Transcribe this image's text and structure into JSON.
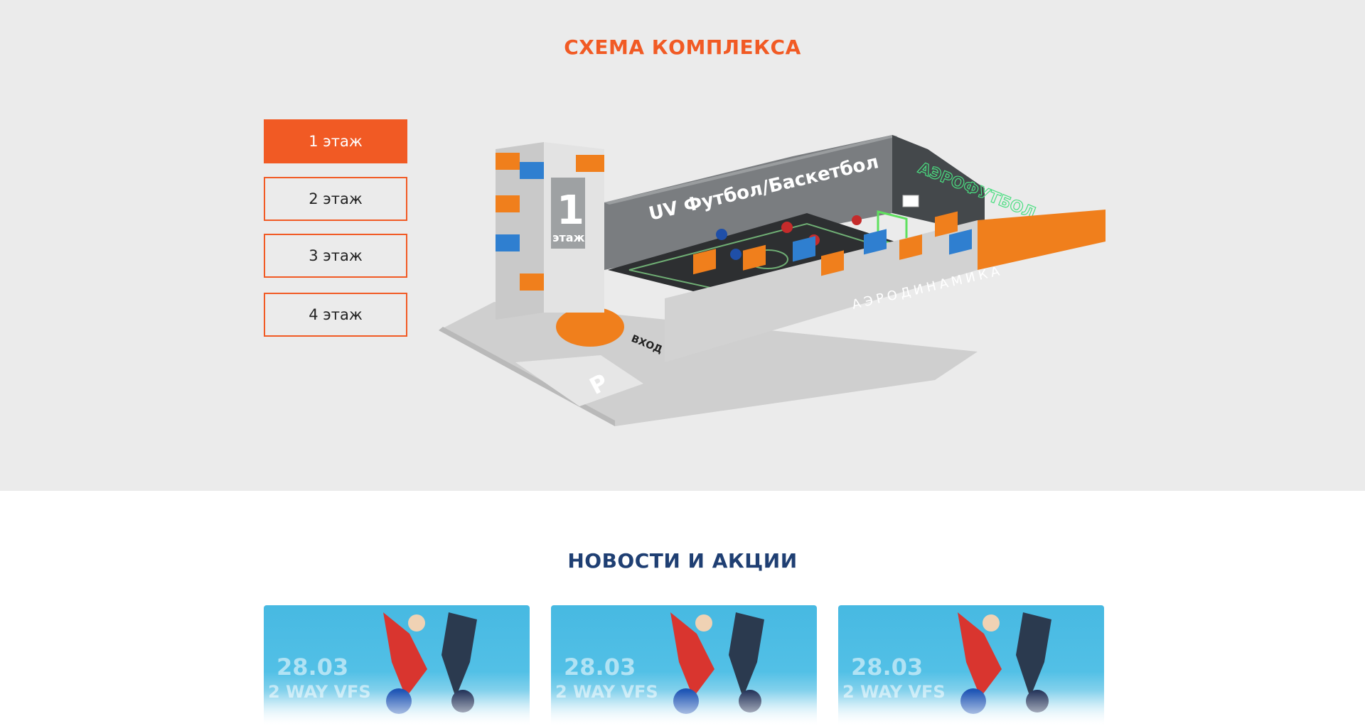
{
  "scheme": {
    "title": "СХЕМА КОМПЛЕКСА",
    "floors": [
      {
        "label": "1 этаж",
        "active": true
      },
      {
        "label": "2 этаж",
        "active": false
      },
      {
        "label": "3 этаж",
        "active": false
      },
      {
        "label": "4 этаж",
        "active": false
      }
    ],
    "map": {
      "floor_number": "1",
      "floor_word": "этаж",
      "zone_football": "UV Футбол/Баскетбол",
      "zone_aerofootball": "АЭРОФУТБОЛ",
      "zone_aerodynamics": "АЭРОДИНАМИКА",
      "entrance": "ВХОД",
      "parking": "P"
    }
  },
  "news": {
    "title": "НОВОСТИ И АКЦИИ",
    "cards": [
      {
        "date": "28.03",
        "subtitle": "2 WAY VFS"
      },
      {
        "date": "28.03",
        "subtitle": "2 WAY VFS"
      },
      {
        "date": "28.03",
        "subtitle": "2 WAY VFS"
      }
    ]
  },
  "colors": {
    "accent": "#f15a24",
    "news_title": "#1f3f73",
    "scheme_bg": "#ebebeb",
    "card_sky": "#47b9e2",
    "block_blue": "#2f7fd0",
    "block_orange": "#f07f1c",
    "block_grey": "#d2d2d2"
  }
}
